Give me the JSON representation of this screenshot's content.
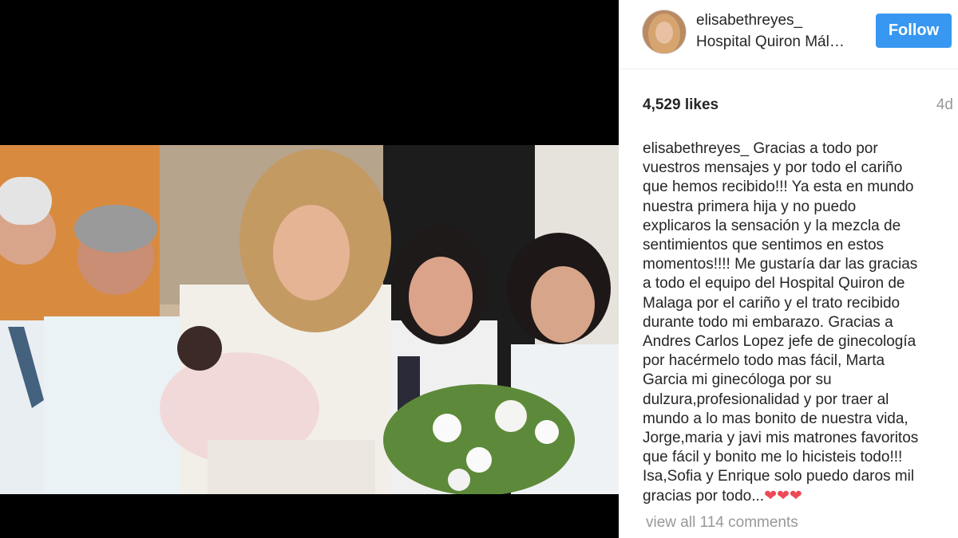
{
  "post": {
    "username": "elisabethreyes_",
    "location": "Hospital Quiron Mál…",
    "follow_label": "Follow",
    "likes": "4,529 likes",
    "time_ago": "4d",
    "caption_user": "elisabethreyes_",
    "caption_lines": [
      " Gracias a todo por",
      "vuestros mensajes y por todo el cariño",
      "que hemos recibido!!! Ya esta en mundo",
      "nuestra primera hija y no puedo",
      "explicaros la sensación y la mezcla de",
      "sentimientos que sentimos en estos",
      "momentos!!!! Me gustaría dar las gracias",
      "a todo el equipo del Hospital Quiron de",
      "Malaga por el cariño y el trato recibido",
      "durante todo mi embarazo. Gracias a",
      "Andres Carlos Lopez jefe de ginecología",
      "por hacérmelo todo mas fácil, Marta",
      "Garcia mi ginecóloga por su",
      "dulzura,profesionalidad y por traer al",
      "mundo a lo mas bonito de nuestra vida,",
      "Jorge,maria y javi mis matrones favoritos",
      "que fácil y bonito me lo hicisteis todo!!!",
      "Isa,Sofia y Enrique solo puedo daros mil",
      "gracias por todo..."
    ],
    "caption_hearts": "❤❤❤",
    "view_comments": "view all 114 comments"
  },
  "colors": {
    "follow_bg": "#3897f0",
    "text": "#262626",
    "muted": "#999999",
    "heart": "#ed4956"
  }
}
